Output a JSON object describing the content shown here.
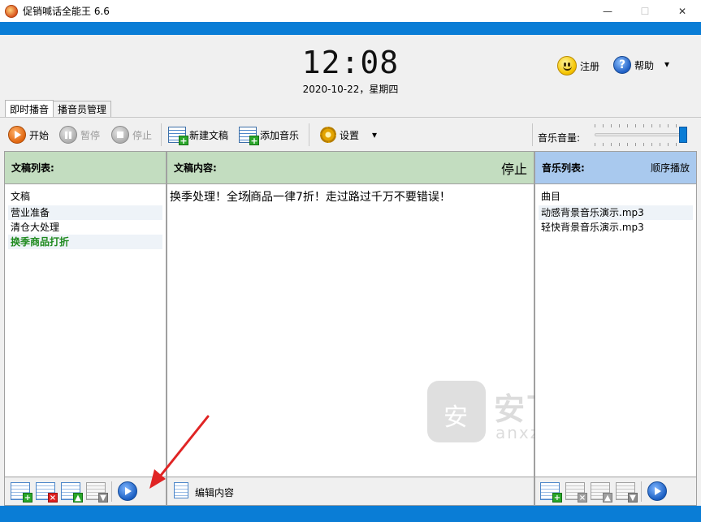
{
  "window": {
    "title": "促销喊话全能王 6.6",
    "minimize_glyph": "—",
    "maximize_glyph": "☐",
    "close_glyph": "✕"
  },
  "header": {
    "time": "12:08",
    "date": "2020-10-22，星期四",
    "register_label": "注册",
    "help_label": "帮助",
    "help_glyph": "?",
    "dropdown_glyph": "▾"
  },
  "tabs": [
    {
      "label": "即时播音",
      "active": true
    },
    {
      "label": "播音员管理",
      "active": false
    }
  ],
  "toolbar": {
    "start_label": "开始",
    "pause_label": "暂停",
    "stop_label": "停止",
    "new_script_label": "新建文稿",
    "add_music_label": "添加音乐",
    "settings_label": "设置",
    "settings_dropdown_glyph": "▾",
    "volume_label": "音乐音量:",
    "volume_level": 1.0
  },
  "scripts_panel": {
    "title": "文稿列表:",
    "column_header": "文稿",
    "items": [
      {
        "label": "营业准备",
        "selected": false
      },
      {
        "label": "清仓大处理",
        "selected": false
      },
      {
        "label": "换季商品打折",
        "selected": true
      }
    ]
  },
  "content_panel": {
    "title": "文稿内容:",
    "status": "停止",
    "text_before_caret": "换季处理！全场",
    "text_after_caret": "商品一律7折！走过路过千万不要错误！",
    "edit_label": "编辑内容"
  },
  "music_panel": {
    "title": "音乐列表:",
    "mode": "顺序播放",
    "column_header": "曲目",
    "items": [
      "动感背景音乐演示.mp3",
      "轻快背景音乐演示.mp3"
    ]
  },
  "watermark": {
    "glyph": "安",
    "brand": "安下载",
    "domain": "anxz.com"
  },
  "colors": {
    "accent_blue": "#0a7dd6",
    "panel_green": "#c3ddc0",
    "panel_blue": "#a9c9ee",
    "selected_text": "#1e8a1e",
    "arrow_red": "#e02424"
  }
}
